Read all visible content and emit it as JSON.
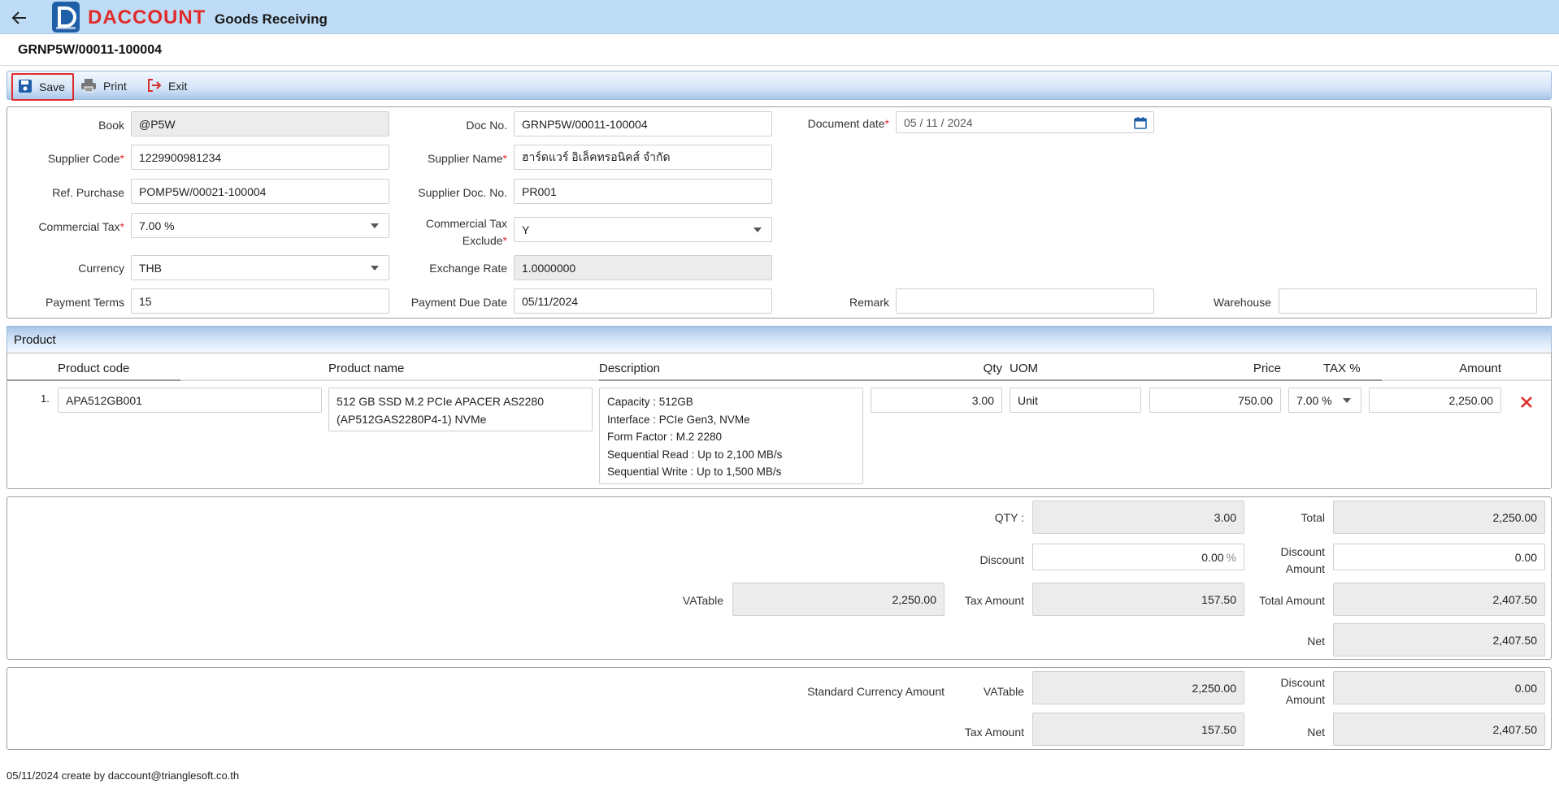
{
  "app": {
    "logo_text": "DACCOUNT",
    "title": "Goods Receiving"
  },
  "doc": {
    "header": "GRNP5W/00011-100004"
  },
  "toolbar": {
    "save": "Save",
    "print": "Print",
    "exit": "Exit"
  },
  "form": {
    "book": {
      "label": "Book",
      "value": "@P5W"
    },
    "doc_no": {
      "label": "Doc No.",
      "value": "GRNP5W/00011-100004"
    },
    "document_date": {
      "label": "Document date",
      "value": "05 / 11 /  2024"
    },
    "supplier_code": {
      "label": "Supplier Code",
      "value": "1229900981234"
    },
    "supplier_name": {
      "label": "Supplier Name",
      "value": "ฮาร์ดแวร์ อิเล็คทรอนิคส์ จำกัด"
    },
    "ref_purchase": {
      "label": "Ref. Purchase",
      "value": "POMP5W/00021-100004"
    },
    "supplier_doc_no": {
      "label": "Supplier Doc. No.",
      "value": "PR001"
    },
    "commercial_tax": {
      "label": "Commercial Tax",
      "value": "7.00 %"
    },
    "commercial_tax_exclude": {
      "label_1": "Commercial Tax",
      "label_2": "Exclude",
      "value": "Y"
    },
    "currency": {
      "label": "Currency",
      "value": "THB"
    },
    "exchange_rate": {
      "label": "Exchange Rate",
      "value": "1.0000000"
    },
    "payment_terms": {
      "label": "Payment Terms",
      "value": "15"
    },
    "payment_due_date": {
      "label": "Payment Due Date",
      "value": "05/11/2024"
    },
    "remark": {
      "label": "Remark",
      "value": ""
    },
    "warehouse": {
      "label": "Warehouse",
      "value": ""
    }
  },
  "product": {
    "section_title": "Product",
    "columns": {
      "code": "Product code",
      "name": "Product name",
      "description": "Description",
      "qty": "Qty",
      "uom": "UOM",
      "price": "Price",
      "tax": "TAX %",
      "amount": "Amount"
    },
    "rows": [
      {
        "index": "1.",
        "code": "APA512GB001",
        "name_lines": [
          "512 GB SSD M.2 PCIe APACER AS2280",
          "(AP512GAS2280P4-1) NVMe"
        ],
        "description_lines": [
          "Capacity : 512GB",
          "Interface : PCIe Gen3, NVMe",
          "Form Factor : M.2 2280",
          "Sequential Read : Up to 2,100 MB/s",
          "Sequential Write : Up to 1,500 MB/s"
        ],
        "qty": "3.00",
        "uom": "Unit",
        "price": "750.00",
        "tax": "7.00 %",
        "amount": "2,250.00"
      }
    ]
  },
  "summary": {
    "qty": {
      "label": "QTY :",
      "value": "3.00"
    },
    "total": {
      "label": "Total",
      "value": "2,250.00"
    },
    "discount": {
      "label": "Discount",
      "value": "0.00",
      "unit": "%"
    },
    "discount_amount": {
      "label_1": "Discount",
      "label_2": "Amount",
      "value": "0.00"
    },
    "vatable": {
      "label": "VATable",
      "value": "2,250.00"
    },
    "tax_amount": {
      "label": "Tax Amount",
      "value": "157.50"
    },
    "total_amount": {
      "label": "Total Amount",
      "value": "2,407.50"
    },
    "net": {
      "label": "Net",
      "value": "2,407.50"
    }
  },
  "standard_currency": {
    "label": "Standard Currency Amount",
    "vatable": {
      "label": "VATable",
      "value": "2,250.00"
    },
    "discount_amount": {
      "label_1": "Discount",
      "label_2": "Amount",
      "value": "0.00"
    },
    "tax_amount": {
      "label": "Tax Amount",
      "value": "157.50"
    },
    "net": {
      "label": "Net",
      "value": "2,407.50"
    }
  },
  "footer": {
    "text": "05/11/2024 create by daccount@trianglesoft.co.th"
  }
}
